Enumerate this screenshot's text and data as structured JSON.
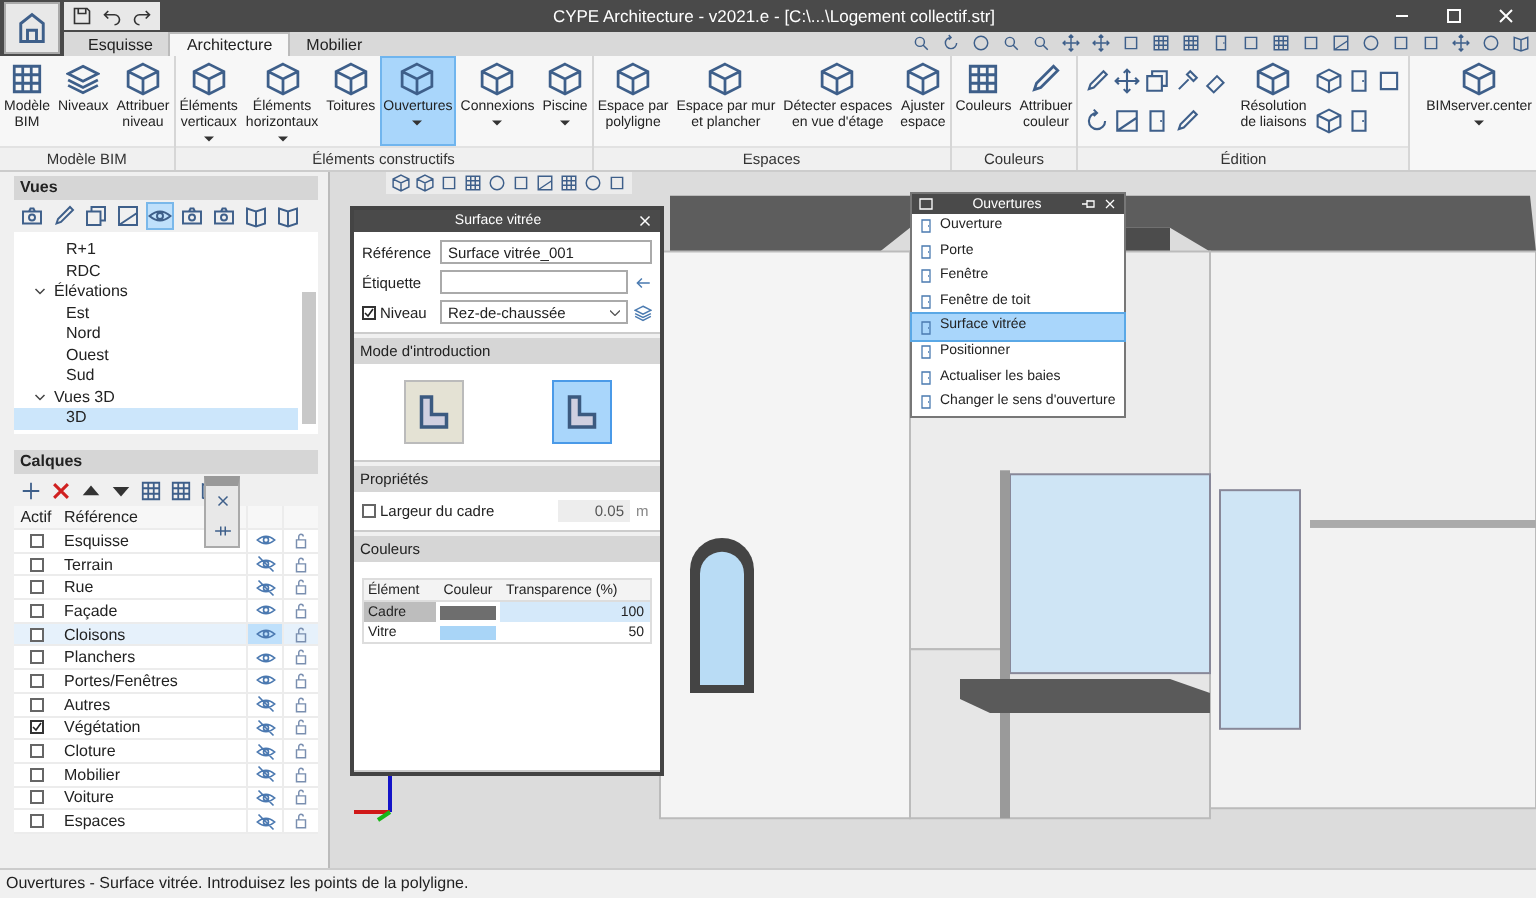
{
  "window": {
    "title": "CYPE Architecture - v2021.e - [C:\\...\\Logement collectif.str]"
  },
  "tabs": [
    {
      "label": "Esquisse",
      "selected": false
    },
    {
      "label": "Architecture",
      "selected": true
    },
    {
      "label": "Mobilier",
      "selected": false
    }
  ],
  "ribbon": [
    {
      "label": "Modèle BIM",
      "kind": "buttons",
      "buttons": [
        {
          "label": "Modèle\nBIM",
          "dropdown": false,
          "selected": false
        },
        {
          "label": "Niveaux",
          "dropdown": false,
          "selected": false
        },
        {
          "label": "Attribuer\nniveau",
          "dropdown": false,
          "selected": false
        }
      ]
    },
    {
      "label": "Éléments constructifs",
      "kind": "buttons",
      "buttons": [
        {
          "label": "Éléments\nverticaux",
          "dropdown": true,
          "selected": false
        },
        {
          "label": "Éléments\nhorizontaux",
          "dropdown": true,
          "selected": false
        },
        {
          "label": "Toitures",
          "dropdown": false,
          "selected": false
        },
        {
          "label": "Ouvertures",
          "dropdown": true,
          "selected": true
        },
        {
          "label": "Connexions",
          "dropdown": true,
          "selected": false
        },
        {
          "label": "Piscine",
          "dropdown": true,
          "selected": false
        }
      ]
    },
    {
      "label": "Espaces",
      "kind": "buttons",
      "buttons": [
        {
          "label": "Espace par\npolyligne",
          "dropdown": false,
          "selected": false
        },
        {
          "label": "Espace par mur\net plancher",
          "dropdown": false,
          "selected": false
        },
        {
          "label": "Détecter espaces\nen vue d'étage",
          "dropdown": false,
          "selected": false
        },
        {
          "label": "Ajuster\nespace",
          "dropdown": false,
          "selected": false
        }
      ]
    },
    {
      "label": "Couleurs",
      "kind": "buttons",
      "buttons": [
        {
          "label": "Couleurs",
          "dropdown": false,
          "selected": false
        },
        {
          "label": "Attribuer\ncouleur",
          "dropdown": false,
          "selected": false
        }
      ]
    },
    {
      "label": "Édition",
      "kind": "tools",
      "buttons": [
        {
          "label": "Résolution\nde liaisons",
          "dropdown": false,
          "selected": false
        }
      ]
    },
    {
      "kind": "buttons",
      "buttons": [
        {
          "label": "BIMserver.center",
          "dropdown": true,
          "selected": false
        }
      ]
    }
  ],
  "views": {
    "title": "Vues",
    "tree": [
      {
        "children": [
          {
            "label": "R+1",
            "selected": false
          },
          {
            "label": "RDC",
            "selected": false
          }
        ]
      },
      {
        "label": "Élévations",
        "expanded": true,
        "selected": false,
        "children": [
          {
            "label": "Est",
            "selected": false
          },
          {
            "label": "Nord",
            "selected": false
          },
          {
            "label": "Ouest",
            "selected": false
          },
          {
            "label": "Sud",
            "selected": false
          }
        ]
      },
      {
        "label": "Vues 3D",
        "expanded": true,
        "selected": false,
        "children": [
          {
            "label": "3D",
            "selected": true
          }
        ]
      }
    ]
  },
  "layers": {
    "title": "Calques",
    "columns": [
      "Actif",
      "Référence"
    ],
    "rows": [
      {
        "name": "Esquisse",
        "active": false,
        "visible": true,
        "selected": false
      },
      {
        "name": "Terrain",
        "active": false,
        "visible": false,
        "selected": false
      },
      {
        "name": "Rue",
        "active": false,
        "visible": false,
        "selected": false
      },
      {
        "name": "Façade",
        "active": false,
        "visible": true,
        "selected": false
      },
      {
        "name": "Cloisons",
        "active": false,
        "visible": true,
        "selected": true
      },
      {
        "name": "Planchers",
        "active": false,
        "visible": true,
        "selected": false
      },
      {
        "name": "Portes/Fenêtres",
        "active": false,
        "visible": true,
        "selected": false
      },
      {
        "name": "Autres",
        "active": false,
        "visible": false,
        "selected": false
      },
      {
        "name": "Végétation",
        "active": true,
        "visible": false,
        "selected": false
      },
      {
        "name": "Cloture",
        "active": false,
        "visible": false,
        "selected": false
      },
      {
        "name": "Mobilier",
        "active": false,
        "visible": false,
        "selected": false
      },
      {
        "name": "Voiture",
        "active": false,
        "visible": false,
        "selected": false
      },
      {
        "name": "Espaces",
        "active": false,
        "visible": false,
        "selected": false
      }
    ]
  },
  "dialog": {
    "title": "Surface vitrée",
    "reference": {
      "label": "Référence",
      "value": "Surface vitrée_001"
    },
    "tag": {
      "label": "Étiquette"
    },
    "level_field": {
      "label": "Niveau",
      "checked": true,
      "value": "Rez-de-chaussée"
    },
    "mode": {
      "title": "Mode d'introduction",
      "options": [
        {
          "selected": false
        },
        {
          "selected": true
        }
      ]
    },
    "properties": {
      "title": "Propriétés",
      "frame_width": {
        "label": "Largeur du cadre",
        "checked": false,
        "value": "0.05",
        "unit": "m"
      }
    },
    "colors": {
      "title": "Couleurs",
      "columns": [
        "Élément",
        "Couleur",
        "Transparence (%)"
      ],
      "rows": [
        {
          "name": "Cadre",
          "color": "#6e6e6e",
          "transparency": "100",
          "selected": true
        },
        {
          "name": "Vitre",
          "color": "#a9d5f7",
          "transparency": "50",
          "selected": false
        }
      ]
    }
  },
  "menu": {
    "title": "Ouvertures",
    "items": [
      {
        "label": "Ouverture",
        "selected": false
      },
      {
        "label": "Porte",
        "selected": false
      },
      {
        "label": "Fenêtre",
        "selected": false
      },
      {
        "label": "Fenêtre de toit",
        "selected": false
      },
      {
        "label": "Surface vitrée",
        "selected": true
      },
      {
        "label": "Positionner",
        "selected": false
      },
      {
        "label": "Actualiser les baies",
        "selected": false
      },
      {
        "label": "Changer le sens d'ouverture",
        "selected": false
      }
    ]
  },
  "status_bar": "Ouvertures - Surface vitrée. Introduisez les points de la polyligne."
}
